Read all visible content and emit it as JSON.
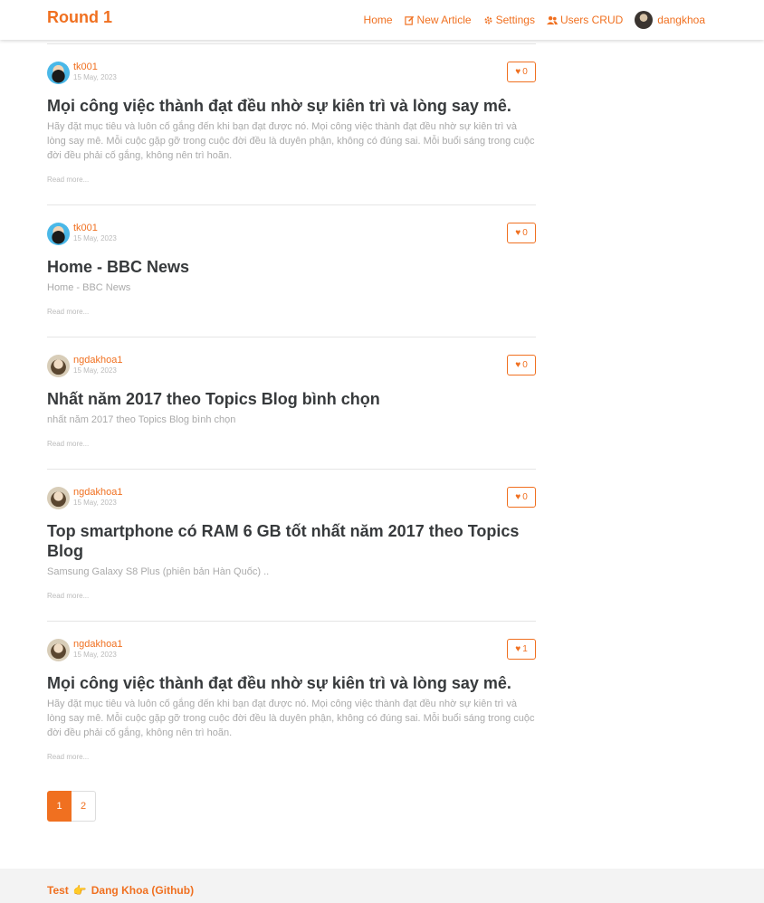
{
  "brand": "Round 1",
  "nav": {
    "home": "Home",
    "new_article": "New Article",
    "settings": "Settings",
    "users_crud": "Users CRUD",
    "user": "dangkhoa"
  },
  "articles": [
    {
      "author": "tk001",
      "date": "15 May, 2023",
      "likes": "0",
      "title": "Mọi công việc thành đạt đều nhờ sự kiên trì và lòng say mê.",
      "description": "Hãy đặt mục tiêu và luôn cố gắng đến khi bạn đạt được nó. Mọi công việc thành đạt đều nhờ sự kiên trì và lòng say mê. Mỗi cuộc gặp gỡ trong cuộc đời đều là duyên phận, không có đúng sai. Mỗi buổi sáng trong cuộc đời đều phải cố gắng, không nên trì hoãn.",
      "read_more": "Read more..."
    },
    {
      "author": "tk001",
      "date": "15 May, 2023",
      "likes": "0",
      "title": "Home - BBC News",
      "description": "Home - BBC News",
      "read_more": "Read more..."
    },
    {
      "author": "ngdakhoa1",
      "date": "15 May, 2023",
      "likes": "0",
      "title": "Nhất năm 2017 theo Topics Blog bình chọn",
      "description": "nhất năm 2017 theo Topics Blog bình chọn",
      "read_more": "Read more..."
    },
    {
      "author": "ngdakhoa1",
      "date": "15 May, 2023",
      "likes": "0",
      "title": "Top smartphone có RAM 6 GB tốt nhất năm 2017 theo Topics Blog",
      "description": "Samsung Galaxy S8 Plus (phiên bản Hàn Quốc) ..",
      "read_more": "Read more..."
    },
    {
      "author": "ngdakhoa1",
      "date": "15 May, 2023",
      "likes": "1",
      "title": "Mọi công việc thành đạt đều nhờ sự kiên trì và lòng say mê.",
      "description": "Hãy đặt mục tiêu và luôn cố gắng đến khi bạn đạt được nó. Mọi công việc thành đạt đều nhờ sự kiên trì và lòng say mê. Mỗi cuộc gặp gỡ trong cuộc đời đều là duyên phận, không có đúng sai. Mỗi buổi sáng trong cuộc đời đều phải cố gắng, không nên trì hoãn.",
      "read_more": "Read more..."
    }
  ],
  "pagination": {
    "pages": [
      "1",
      "2"
    ],
    "active": "1"
  },
  "footer": {
    "prefix": "Test",
    "link": "Dang Khoa (Github)"
  },
  "colors": {
    "accent": "#f07020"
  }
}
